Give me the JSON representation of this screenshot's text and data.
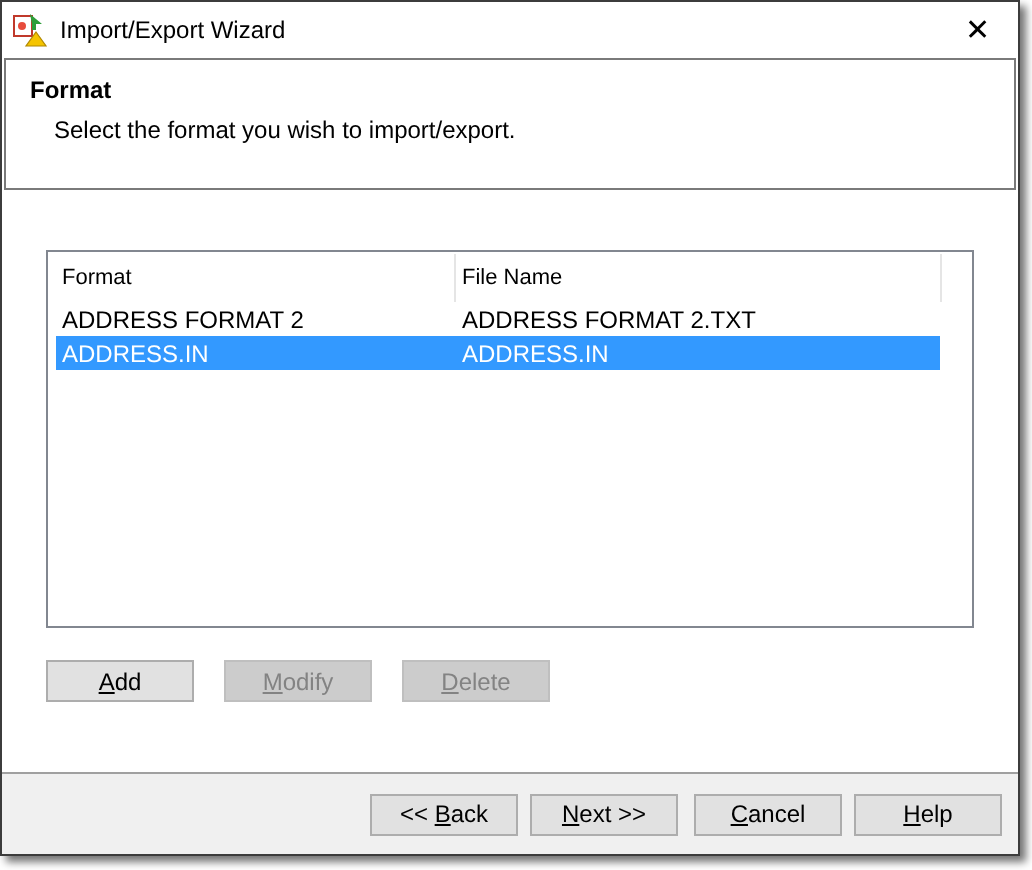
{
  "window": {
    "title": "Import/Export Wizard",
    "close": "✕"
  },
  "header": {
    "title": "Format",
    "subtitle": "Select the format you wish to import/export."
  },
  "table": {
    "columns": [
      "Format",
      "File Name"
    ],
    "rows": [
      {
        "cells": [
          "ADDRESS FORMAT 2",
          "ADDRESS FORMAT 2.TXT"
        ],
        "selected": false
      },
      {
        "cells": [
          "ADDRESS.IN",
          "ADDRESS.IN"
        ],
        "selected": true
      }
    ]
  },
  "list_buttons": [
    {
      "access_key": "A",
      "label_rest": "dd",
      "disabled": false
    },
    {
      "access_key": "M",
      "label_rest": "odify",
      "disabled": true
    },
    {
      "access_key": "D",
      "label_rest": "elete",
      "disabled": true
    }
  ],
  "footer_buttons": [
    {
      "label_prefix": "<< ",
      "access_key": "B",
      "label_rest": "ack",
      "disabled": false
    },
    {
      "access_key": "N",
      "label_rest": "ext >>",
      "disabled": false
    },
    {
      "access_key": "C",
      "label_rest": "ancel",
      "disabled": false
    },
    {
      "access_key": "H",
      "label_rest": "elp",
      "disabled": false
    }
  ]
}
